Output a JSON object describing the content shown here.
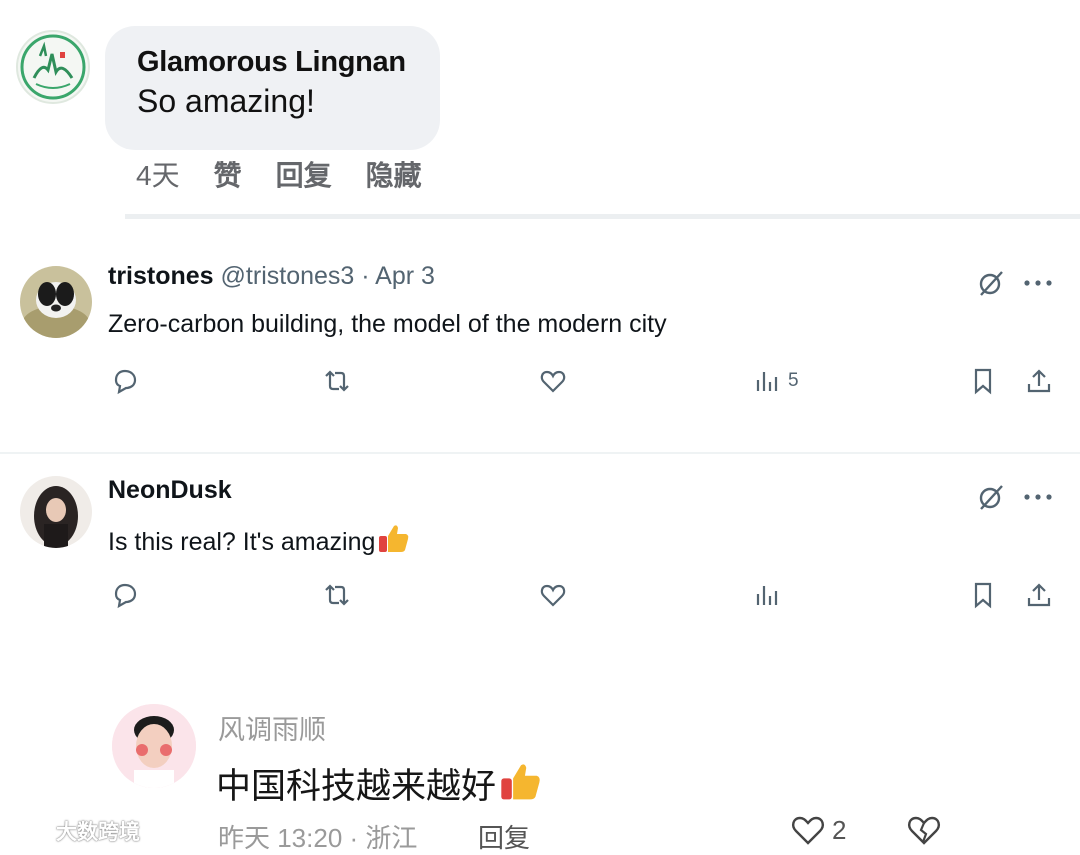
{
  "fb_comment": {
    "author": "Glamorous Lingnan",
    "text": "So amazing!",
    "time": "4天",
    "like_label": "赞",
    "reply_label": "回复",
    "hide_label": "隐藏"
  },
  "tweets": [
    {
      "name": "tristones",
      "meta": " @tristones3 · Apr 3",
      "text": "Zero-carbon building, the model of the modern city",
      "views": "5"
    },
    {
      "name": "NeonDusk",
      "meta": "",
      "text": "Is this real? It's amazing",
      "views": ""
    }
  ],
  "douyin_comment": {
    "author": "风调雨顺",
    "text": "中国科技越来越好",
    "meta": "昨天 13:20 · 浙江",
    "reply_label": "回复",
    "likes": "2"
  },
  "watermark": "大数跨境",
  "colors": {
    "bubble_bg": "#eff1f4",
    "meta_gray": "#536471",
    "fb_action_gray": "#65676b",
    "thumbs_yellow": "#f5b62f",
    "sleeve_red": "#e0433f"
  },
  "icons": [
    "reply-icon",
    "retweet-icon",
    "like-icon",
    "views-icon",
    "bookmark-icon",
    "share-icon",
    "grok-icon",
    "more-icon",
    "heart-icon",
    "broken-heart-icon"
  ]
}
